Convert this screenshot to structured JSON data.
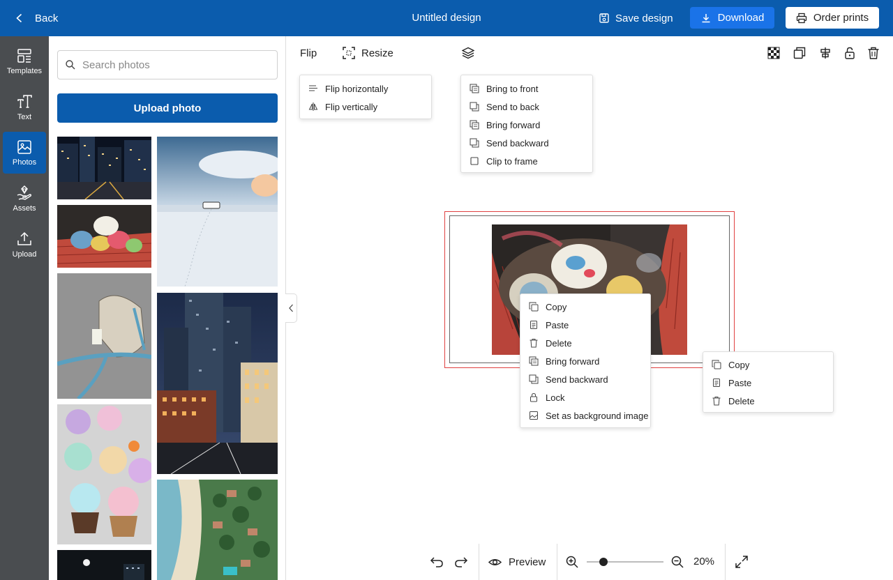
{
  "topbar": {
    "back_label": "Back",
    "title": "Untitled design",
    "save_label": "Save design",
    "download_label": "Download",
    "order_label": "Order prints",
    "bg_color": "#0b5cad"
  },
  "rail": {
    "items": [
      {
        "label": "Templates",
        "icon": "templates-icon"
      },
      {
        "label": "Text",
        "icon": "text-icon"
      },
      {
        "label": "Photos",
        "icon": "photos-icon",
        "active": true
      },
      {
        "label": "Assets",
        "icon": "assets-icon"
      },
      {
        "label": "Upload",
        "icon": "upload-icon"
      }
    ]
  },
  "panel": {
    "search_placeholder": "Search photos",
    "upload_label": "Upload photo",
    "photos": [
      "city-night",
      "snow-landscape",
      "easter-basket",
      "bicycle-basket",
      "city-buildings-dusk",
      "cupcakes",
      "aerial-beach",
      "city-night-dark"
    ]
  },
  "toolbar": {
    "flip_label": "Flip",
    "resize_label": "Resize",
    "right_icons": [
      "transparency-icon",
      "duplicate-icon",
      "align-icon",
      "lock-icon",
      "trash-icon"
    ]
  },
  "flip_menu": {
    "items": [
      "Flip horizontally",
      "Flip vertically"
    ]
  },
  "layer_menu": {
    "items": [
      "Bring to front",
      "Send to back",
      "Bring forward",
      "Send backward",
      "Clip to frame"
    ]
  },
  "context_menu_photo": {
    "items": [
      "Copy",
      "Paste",
      "Delete",
      "Bring forward",
      "Send backward",
      "Lock",
      "Set as background image"
    ]
  },
  "context_menu_canvas": {
    "items": [
      "Copy",
      "Paste",
      "Delete"
    ]
  },
  "bottombar": {
    "preview_label": "Preview",
    "zoom_value": "20%",
    "zoom_level": 0.2
  },
  "colors": {
    "accent": "#0b5cad",
    "download": "#1a73e8",
    "rail_bg": "#4a4d50",
    "selection": "#e04040"
  }
}
